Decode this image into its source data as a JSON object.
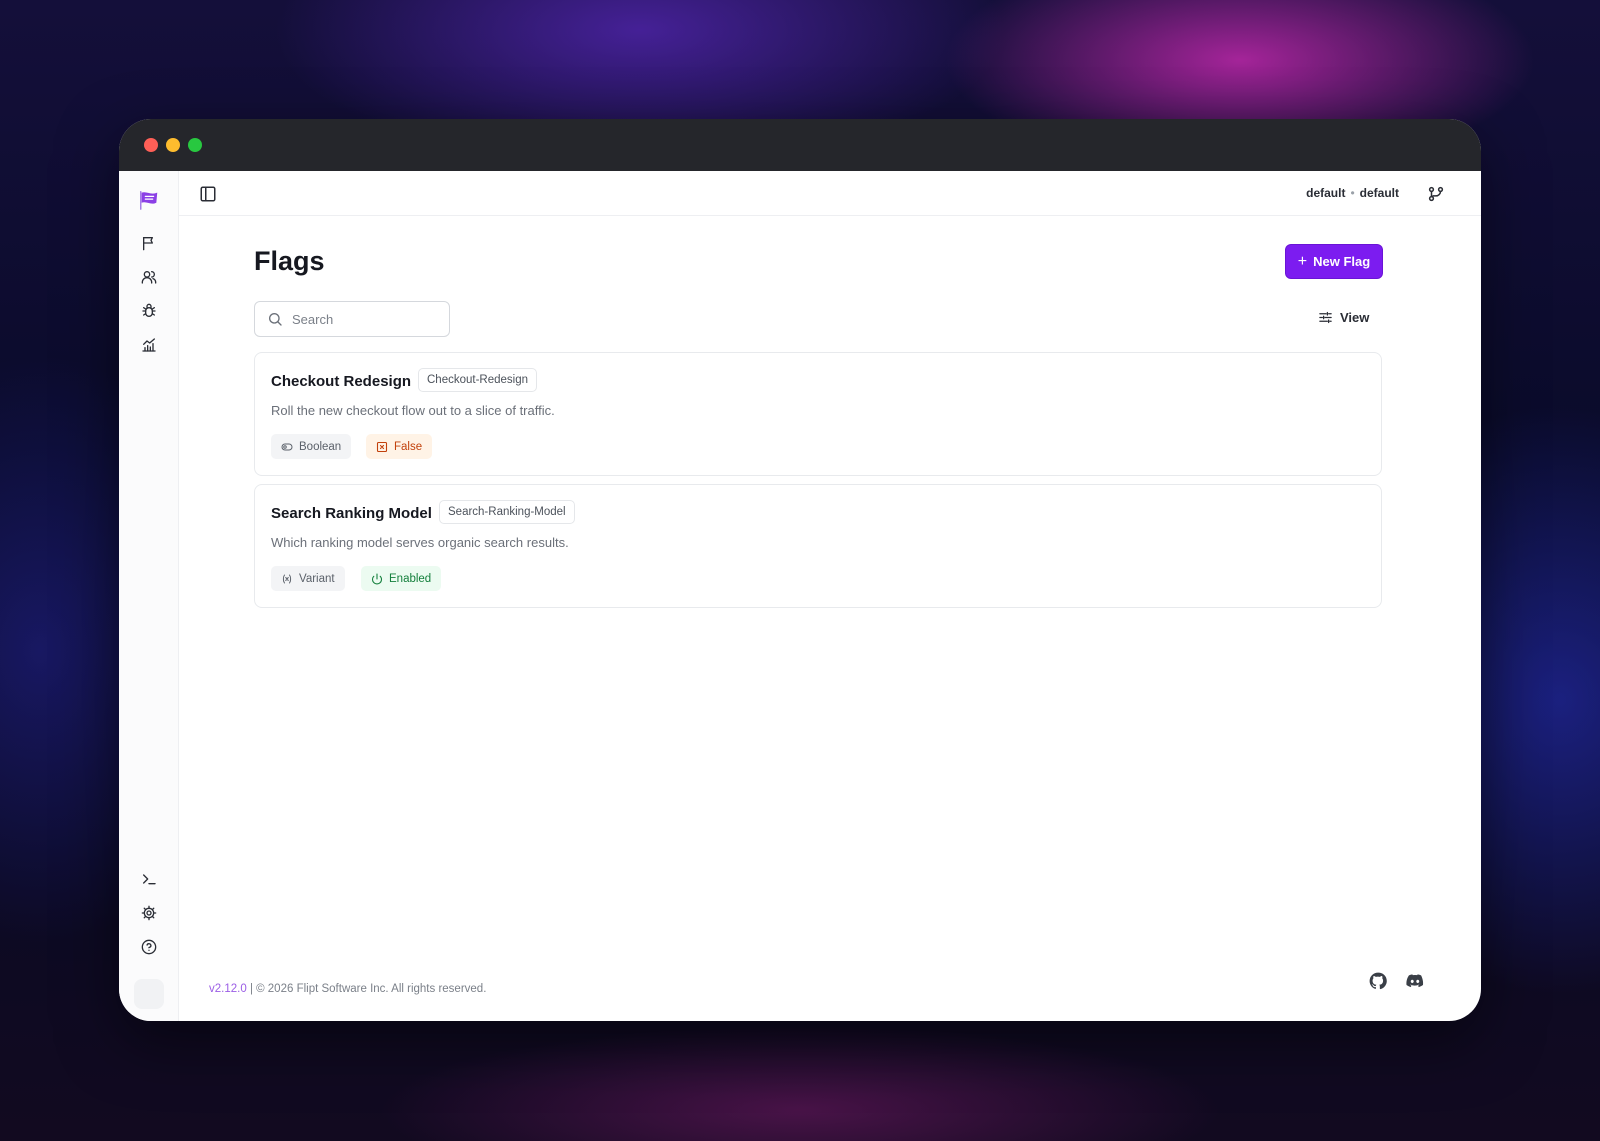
{
  "namespace": {
    "environment": "default",
    "separator": "•",
    "namespace": "default"
  },
  "page": {
    "title": "Flags"
  },
  "actions": {
    "new_flag_label": "New Flag",
    "view_label": "View"
  },
  "search": {
    "placeholder": "Search",
    "value": ""
  },
  "flags": [
    {
      "name": "Checkout Redesign",
      "key": "Checkout-Redesign",
      "description": "Roll the new checkout flow out to a slice of traffic.",
      "type": "Boolean",
      "status": "False",
      "status_color": "#c2410c"
    },
    {
      "name": "Search Ranking Model",
      "key": "Search-Ranking-Model",
      "description": "Which ranking model serves organic search results.",
      "type": "Variant",
      "status": "Enabled",
      "status_color": "#15803d"
    }
  ],
  "sidebar": {
    "items": [
      "flag-icon",
      "users-icon",
      "bug-icon",
      "analytics-icon"
    ],
    "bottom_items": [
      "terminal-icon",
      "gear-icon",
      "help-icon"
    ]
  },
  "footer": {
    "version": "v2.12.0",
    "copyright": "| © 2026 Flipt Software Inc. All rights reserved."
  },
  "colors": {
    "accent": "#7c1cf0",
    "titlebar": "#25262b"
  }
}
